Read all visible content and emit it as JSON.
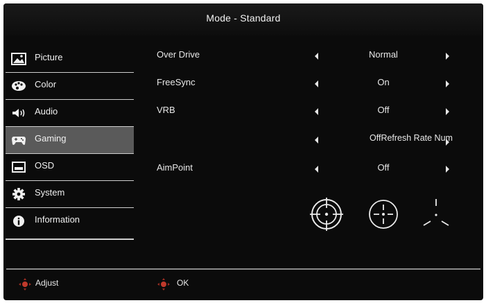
{
  "header": {
    "title": "Mode - Standard"
  },
  "sidebar": {
    "items": [
      {
        "label": "Picture",
        "icon": "picture-icon"
      },
      {
        "label": "Color",
        "icon": "palette-icon"
      },
      {
        "label": "Audio",
        "icon": "speaker-icon"
      },
      {
        "label": "Gaming",
        "icon": "gamepad-icon",
        "active": true
      },
      {
        "label": "OSD",
        "icon": "osd-window-icon"
      },
      {
        "label": "System",
        "icon": "gear-icon"
      },
      {
        "label": "Information",
        "icon": "info-icon"
      }
    ]
  },
  "settings": {
    "rows": [
      {
        "name": "Over Drive",
        "value": "Normal"
      },
      {
        "name": "FreeSync",
        "value": "On"
      },
      {
        "name": "VRB",
        "value": "Off"
      },
      {
        "name": "",
        "value": "OffRefresh Rate Num"
      },
      {
        "name": "AimPoint",
        "value": "Off"
      }
    ]
  },
  "footer": {
    "adjust_label": "Adjust",
    "ok_label": "OK"
  },
  "colors": {
    "background": "#0b0b0b",
    "active_item": "#5a5a5a",
    "text": "#e8e8e8",
    "joystick_accent": "#c0392b"
  }
}
